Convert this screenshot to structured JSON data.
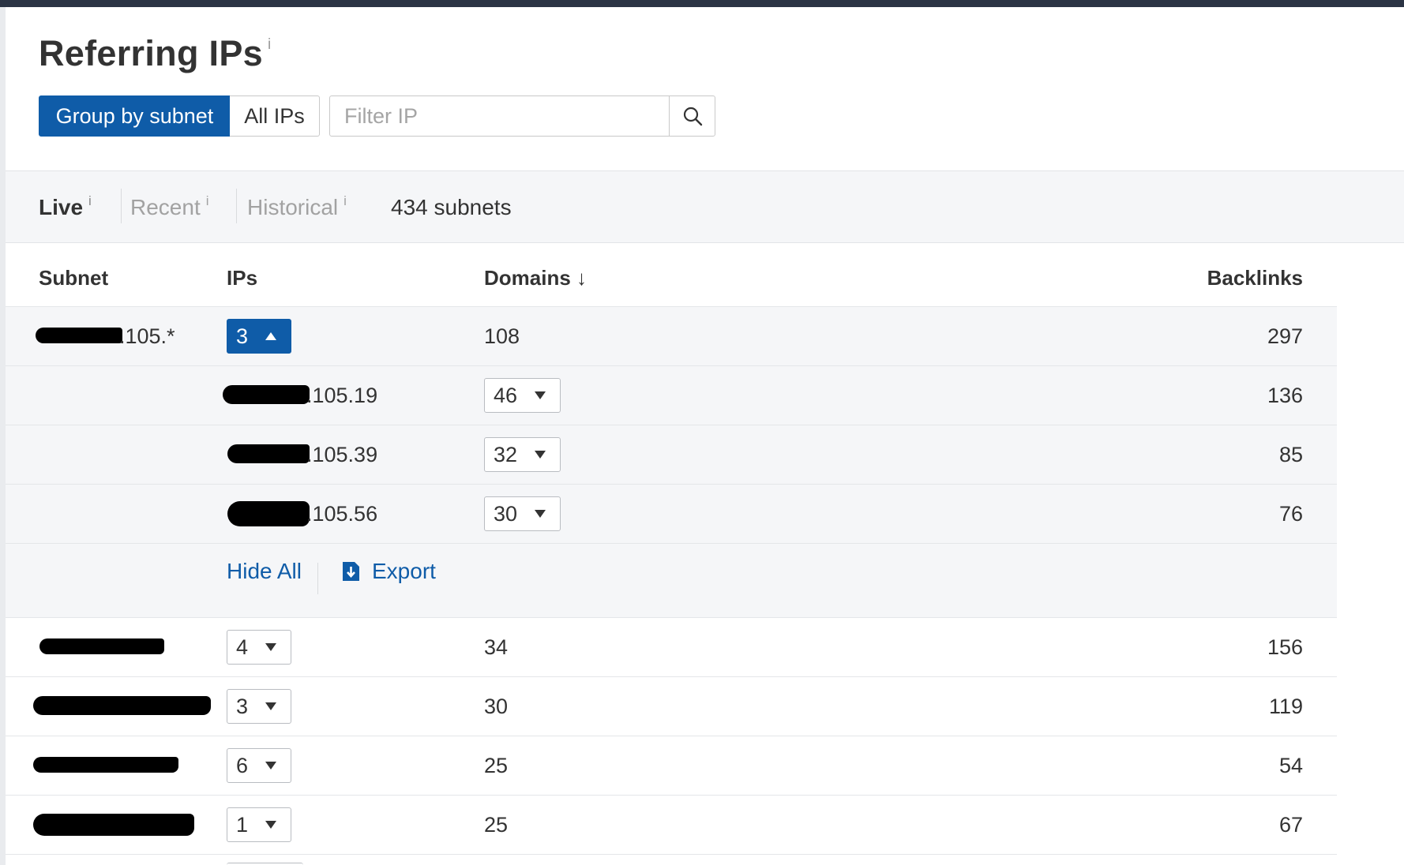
{
  "page": {
    "title": "Referring IPs",
    "title_info": "i"
  },
  "controls": {
    "group_by_subnet": "Group by subnet",
    "all_ips": "All IPs",
    "filter_placeholder": "Filter IP",
    "search_icon": "search-icon"
  },
  "tabs": {
    "live": "Live",
    "recent": "Recent",
    "historical": "Historical",
    "info": "i",
    "active": "live"
  },
  "summary": {
    "count_text": "434 subnets"
  },
  "table": {
    "headers": {
      "subnet": "Subnet",
      "ips": "IPs",
      "domains": "Domains",
      "domains_sort": "↓",
      "backlinks": "Backlinks"
    },
    "expanded_group": {
      "subnet_suffix": ".105.*",
      "ips_count": "3",
      "domains": "108",
      "backlinks": "297",
      "children": [
        {
          "ip_suffix": ".105.19",
          "domains": "46",
          "backlinks": "136"
        },
        {
          "ip_suffix": ".105.39",
          "domains": "32",
          "backlinks": "85"
        },
        {
          "ip_suffix": ".105.56",
          "domains": "30",
          "backlinks": "76"
        }
      ],
      "actions": {
        "hide_all": "Hide All",
        "export": "Export"
      }
    },
    "rows": [
      {
        "ips_count": "4",
        "domains": "34",
        "backlinks": "156"
      },
      {
        "ips_count": "3",
        "domains": "30",
        "backlinks": "119"
      },
      {
        "ips_count": "6",
        "domains": "25",
        "backlinks": "54"
      },
      {
        "ips_count": "1",
        "domains": "25",
        "backlinks": "67"
      }
    ]
  },
  "colors": {
    "accent": "#0f5ca8",
    "topbar": "#2b3444",
    "row_shade": "#f5f6f8"
  }
}
